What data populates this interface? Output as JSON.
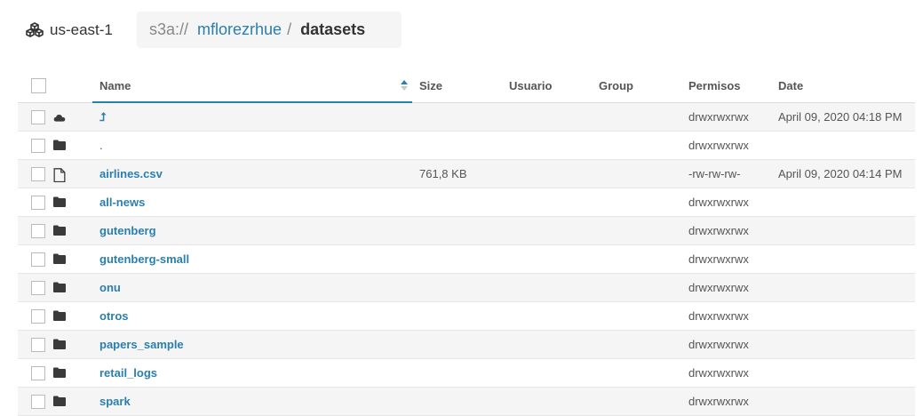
{
  "region": {
    "label": "us-east-1",
    "icon": "aws-cubes-icon"
  },
  "breadcrumb": {
    "scheme": "s3a://",
    "bucket": "mflorezrhue",
    "separator": "/",
    "current": "datasets"
  },
  "columns": {
    "name": "Name",
    "size": "Size",
    "user": "Usuario",
    "group": "Group",
    "permissions": "Permisos",
    "date": "Date"
  },
  "sort": {
    "column": "name",
    "direction": "ascending",
    "icon": "sort-ascending-icon"
  },
  "rows": [
    {
      "type": "parent",
      "icon": "cloud-icon",
      "name": "⮥",
      "size": "",
      "user": "",
      "group": "",
      "permissions": "drwxrwxrwx",
      "date": "April 09, 2020 04:18 PM",
      "link": true
    },
    {
      "type": "current",
      "icon": "folder-icon",
      "name": ".",
      "size": "",
      "user": "",
      "group": "",
      "permissions": "drwxrwxrwx",
      "date": "",
      "link": false
    },
    {
      "type": "file",
      "icon": "file-icon",
      "name": "airlines.csv",
      "size": "761,8 KB",
      "user": "",
      "group": "",
      "permissions": "-rw-rw-rw-",
      "date": "April 09, 2020 04:14 PM",
      "link": true
    },
    {
      "type": "dir",
      "icon": "folder-icon",
      "name": "all-news",
      "size": "",
      "user": "",
      "group": "",
      "permissions": "drwxrwxrwx",
      "date": "",
      "link": true
    },
    {
      "type": "dir",
      "icon": "folder-icon",
      "name": "gutenberg",
      "size": "",
      "user": "",
      "group": "",
      "permissions": "drwxrwxrwx",
      "date": "",
      "link": true
    },
    {
      "type": "dir",
      "icon": "folder-icon",
      "name": "gutenberg-small",
      "size": "",
      "user": "",
      "group": "",
      "permissions": "drwxrwxrwx",
      "date": "",
      "link": true
    },
    {
      "type": "dir",
      "icon": "folder-icon",
      "name": "onu",
      "size": "",
      "user": "",
      "group": "",
      "permissions": "drwxrwxrwx",
      "date": "",
      "link": true
    },
    {
      "type": "dir",
      "icon": "folder-icon",
      "name": "otros",
      "size": "",
      "user": "",
      "group": "",
      "permissions": "drwxrwxrwx",
      "date": "",
      "link": true
    },
    {
      "type": "dir",
      "icon": "folder-icon",
      "name": "papers_sample",
      "size": "",
      "user": "",
      "group": "",
      "permissions": "drwxrwxrwx",
      "date": "",
      "link": true
    },
    {
      "type": "dir",
      "icon": "folder-icon",
      "name": "retail_logs",
      "size": "",
      "user": "",
      "group": "",
      "permissions": "drwxrwxrwx",
      "date": "",
      "link": true
    },
    {
      "type": "dir",
      "icon": "folder-icon",
      "name": "spark",
      "size": "",
      "user": "",
      "group": "",
      "permissions": "drwxrwxrwx",
      "date": "",
      "link": true
    }
  ],
  "colors": {
    "link": "#2a7fad",
    "stripe": "#f5f5f5",
    "icon": "#3a3a3a"
  }
}
